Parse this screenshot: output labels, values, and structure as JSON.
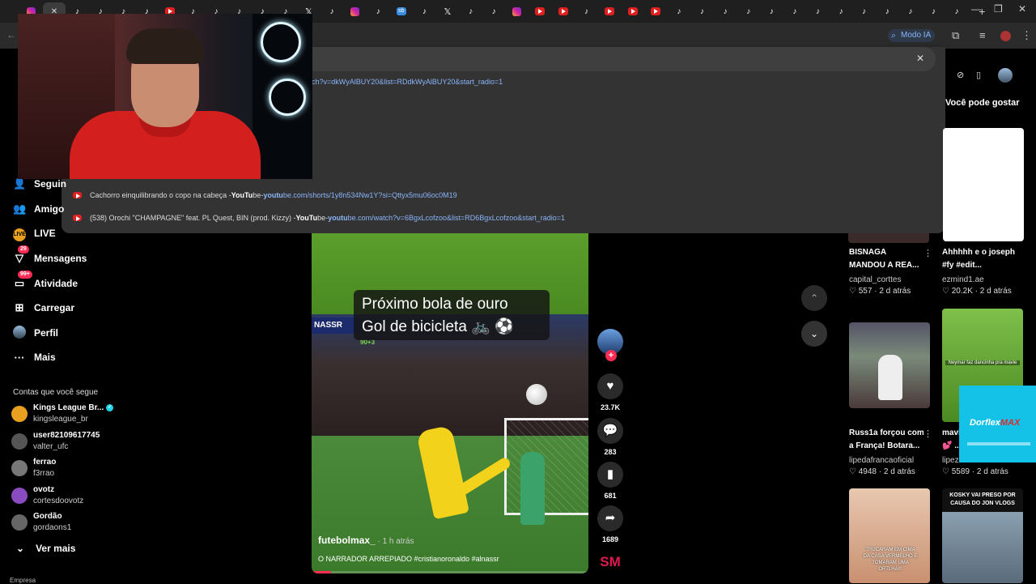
{
  "tabs": [
    {
      "fav": "ig"
    },
    {
      "fav": "close",
      "active": true
    },
    {
      "fav": "tt"
    },
    {
      "fav": "tt"
    },
    {
      "fav": "tt"
    },
    {
      "fav": "tt"
    },
    {
      "fav": "yt"
    },
    {
      "fav": "tt"
    },
    {
      "fav": "tt"
    },
    {
      "fav": "tt"
    },
    {
      "fav": "tt"
    },
    {
      "fav": "tt"
    },
    {
      "fav": "x"
    },
    {
      "fav": "tt"
    },
    {
      "fav": "ig"
    },
    {
      "fav": "tt"
    },
    {
      "fav": "sb"
    },
    {
      "fav": "tt"
    },
    {
      "fav": "x"
    },
    {
      "fav": "tt"
    },
    {
      "fav": "tt"
    },
    {
      "fav": "ig"
    },
    {
      "fav": "yt"
    },
    {
      "fav": "yt"
    },
    {
      "fav": "tt"
    },
    {
      "fav": "yt"
    },
    {
      "fav": "yt"
    },
    {
      "fav": "yt"
    },
    {
      "fav": "tt"
    },
    {
      "fav": "tt"
    },
    {
      "fav": "tt"
    },
    {
      "fav": "tt"
    },
    {
      "fav": "tt"
    },
    {
      "fav": "tt"
    },
    {
      "fav": "tt"
    },
    {
      "fav": "tt"
    },
    {
      "fav": "tt"
    },
    {
      "fav": "tt"
    },
    {
      "fav": "tt"
    },
    {
      "fav": "tt"
    },
    {
      "fav": "tt"
    }
  ],
  "toolbar": {
    "modo_ia": "Modo IA"
  },
  "omnibox": {
    "url_suffix": "ch?v=dkWyAlBUY20&list=RDdkWyAlBUY20&start_radio=1",
    "suggestions": [
      {
        "title": "Cachorro einquilibrando o copo na cabeça - ",
        "site_a": "YouTu",
        "site_b": "be",
        "sep": " - ",
        "url_a": "youtu",
        "url_b": "be.com/shorts/1y8n534Nw1Y?si=Qttyx5mu06oc0M19"
      },
      {
        "title": "(538) Orochi \"CHAMPAGNE\" feat. PL Quest, BIN (prod. Kizzy) - ",
        "site_a": "YouTu",
        "site_b": "be",
        "sep": " - ",
        "url_a": "youtu",
        "url_b": "be.com/watch?v=6BgxLcofzoo&list=RD6BgxLcofzoo&start_radio=1"
      }
    ]
  },
  "nav": [
    {
      "label": "Seguin",
      "icon": "follow-icon"
    },
    {
      "label": "Amigo",
      "icon": "friends-icon"
    },
    {
      "label": "LIVE",
      "icon": "live-icon"
    },
    {
      "label": "Mensagens",
      "icon": "messages-icon",
      "badge": "29"
    },
    {
      "label": "Atividade",
      "icon": "activity-icon",
      "badge": "99+"
    },
    {
      "label": "Carregar",
      "icon": "upload-icon"
    },
    {
      "label": "Perfil",
      "icon": "profile-icon"
    },
    {
      "label": "Mais",
      "icon": "more-icon"
    }
  ],
  "following": {
    "heading": "Contas que você segue",
    "accounts": [
      {
        "name": "Kings League Br...",
        "handle": "kingsleague_br",
        "verified": true
      },
      {
        "name": "user82109617745",
        "handle": "valter_ufc"
      },
      {
        "name": "ferrao",
        "handle": "f3rrao"
      },
      {
        "name": "ovotz",
        "handle": "cortesdoovotz"
      },
      {
        "name": "Gordão",
        "handle": "gordaons1"
      }
    ],
    "see_more": "Ver mais",
    "company": "Empresa"
  },
  "video": {
    "caption_line1": "Próximo bola de ouro",
    "caption_line2": "Gol de bicicleta 🚲 ⚽",
    "board": "NASSR",
    "score": "90+3",
    "username": "futebolmax_",
    "time": " · 1 h atrás",
    "description": "O NARRADOR ARREPIADO #cristianoronaldo #alnassr",
    "progress": 0.07
  },
  "actions": {
    "likes": "23.7K",
    "comments": "283",
    "saves": "681",
    "shares": "1689",
    "plus": "+"
  },
  "right": {
    "heading": "Você pode gostar",
    "cards": [
      {
        "title": "BISNAGA",
        "title2": "MANDOU A REA...",
        "author": "capital_corttes",
        "likes": "557",
        "age": "2 d atrás"
      },
      {
        "title": "Ahhhhh e o joseph",
        "title2": "#fy #edit...",
        "author": "ezmind1.ae",
        "likes": "20.2K",
        "age": "2 d atrás"
      },
      {
        "title": "Russ1a forçou com",
        "title2": "a França! Botara...",
        "author": "lipedafrancaoficial",
        "likes": "4948",
        "age": "2 d atrás"
      },
      {
        "title": "mavi",
        "title2": "💕 ...",
        "author": "lipez",
        "likes": "5589",
        "age": "2 d atrás"
      }
    ],
    "thumb_texts": {
      "neymar": "Neymar faz dancinha pra mavie",
      "kosky": "KOSKY VAI PRESO POR CAUSA DO JON VLOGS",
      "truque": "TRUCARAM EM CIMA DA CASA VERMELHO E TOMARAM UMA ORTLHA!!!"
    }
  },
  "ad": {
    "brand_a": "Dorflex",
    "brand_b": "MAX"
  },
  "sm_logo": "SM"
}
